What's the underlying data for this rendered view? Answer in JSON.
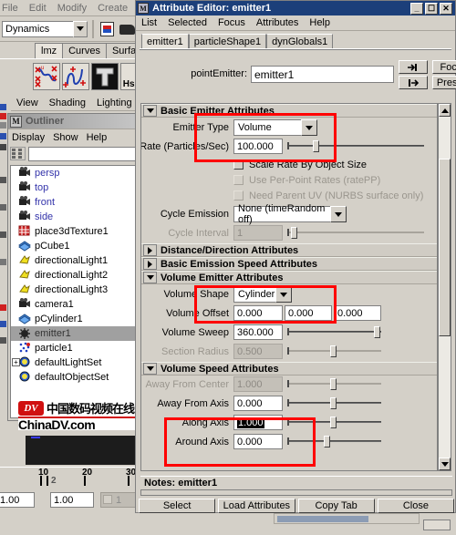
{
  "maya": {
    "menubar": [
      "File",
      "Edit",
      "Modify",
      "Create",
      "D"
    ],
    "menu_mode": "Dynamics",
    "shelf_tabs": [
      {
        "label": "lmz",
        "active": true
      },
      {
        "label": "Curves",
        "active": false
      },
      {
        "label": "Surface:",
        "active": false
      }
    ],
    "shelf_icons": [
      "scatter-curve-icon",
      "wave-curve-icon",
      "text-tool-icon",
      "hshc-icon",
      "ab-icon"
    ],
    "viewport_menu": [
      "View",
      "Shading",
      "Lighting"
    ],
    "outliner": {
      "title": "Outliner",
      "menu": [
        "Display",
        "Show",
        "Help"
      ],
      "search_value": "",
      "items": [
        {
          "label": "persp",
          "icon": "camera-icon",
          "blue": true,
          "selected": false,
          "expand": false
        },
        {
          "label": "top",
          "icon": "camera-icon",
          "blue": true,
          "selected": false,
          "expand": false
        },
        {
          "label": "front",
          "icon": "camera-icon",
          "blue": true,
          "selected": false,
          "expand": false
        },
        {
          "label": "side",
          "icon": "camera-icon",
          "blue": true,
          "selected": false,
          "expand": false
        },
        {
          "label": "place3dTexture1",
          "icon": "place3d-texture-icon",
          "blue": false,
          "selected": false,
          "expand": false
        },
        {
          "label": "pCube1",
          "icon": "mesh-icon",
          "blue": false,
          "selected": false,
          "expand": false
        },
        {
          "label": "directionalLight1",
          "icon": "directional-light-icon",
          "blue": false,
          "selected": false,
          "expand": false
        },
        {
          "label": "directionalLight2",
          "icon": "directional-light-icon",
          "blue": false,
          "selected": false,
          "expand": false
        },
        {
          "label": "directionalLight3",
          "icon": "directional-light-icon",
          "blue": false,
          "selected": false,
          "expand": false
        },
        {
          "label": "camera1",
          "icon": "camera-icon",
          "blue": false,
          "selected": false,
          "expand": false
        },
        {
          "label": "pCylinder1",
          "icon": "mesh-icon",
          "blue": false,
          "selected": false,
          "expand": false
        },
        {
          "label": "emitter1",
          "icon": "emitter-icon",
          "blue": false,
          "selected": true,
          "expand": false
        },
        {
          "label": "particle1",
          "icon": "particle-icon",
          "blue": false,
          "selected": false,
          "expand": false
        },
        {
          "label": "defaultLightSet",
          "icon": "set-icon",
          "blue": false,
          "selected": false,
          "expand": true
        },
        {
          "label": "defaultObjectSet",
          "icon": "set-icon",
          "blue": false,
          "selected": false,
          "expand": false
        }
      ]
    },
    "watermark": {
      "badge": "DV",
      "chinese": "中国数码视频在线",
      "domain": "ChinaDV.com"
    },
    "timeline": {
      "ticks": [
        "10",
        "20",
        "30"
      ],
      "current_frame": "2"
    },
    "fields": {
      "field1": "1.00",
      "field2": "1.00",
      "field3": "1"
    }
  },
  "attribute_editor": {
    "title": "Attribute Editor: emitter1",
    "window_buttons": [
      "minimize",
      "maximize",
      "close"
    ],
    "menu": [
      "List",
      "Selected",
      "Focus",
      "Attributes",
      "Help"
    ],
    "tabs": [
      {
        "label": "emitter1",
        "active": true
      },
      {
        "label": "particleShape1",
        "active": false
      },
      {
        "label": "dynGlobals1",
        "active": false
      }
    ],
    "node_label": "pointEmitter:",
    "node_value": "emitter1",
    "side_buttons": [
      "Focus",
      "Presets"
    ],
    "sections": [
      {
        "name": "Basic Emitter Attributes",
        "expanded": true,
        "rows": [
          {
            "type": "dropdown",
            "label": "Emitter Type",
            "value": "Volume"
          },
          {
            "type": "field_slider",
            "label": "Rate (Particles/Sec)",
            "value": "100.000",
            "disabled": false,
            "handle_pct": 18
          },
          {
            "type": "checkbox",
            "label": "Scale Rate By Object Size",
            "checked": false,
            "disabled": false
          },
          {
            "type": "checkbox",
            "label": "Use Per-Point Rates (ratePP)",
            "checked": false,
            "disabled": true
          },
          {
            "type": "checkbox",
            "label": "Need Parent UV (NURBS surface only)",
            "checked": false,
            "disabled": true
          },
          {
            "type": "dropdown",
            "label": "Cycle Emission",
            "value": "None (timeRandom off)"
          },
          {
            "type": "field_slider",
            "label": "Cycle Interval",
            "value": "1",
            "disabled": true,
            "handle_pct": 4
          }
        ]
      },
      {
        "name": "Distance/Direction Attributes",
        "expanded": false,
        "rows": []
      },
      {
        "name": "Basic Emission Speed Attributes",
        "expanded": false,
        "rows": []
      },
      {
        "name": "Volume Emitter Attributes",
        "expanded": true,
        "rows": [
          {
            "type": "dropdown",
            "label": "Volume Shape",
            "value": "Cylinder"
          },
          {
            "type": "triple_field",
            "label": "Volume Offset",
            "values": [
              "0.000",
              "0.000",
              "0.000"
            ]
          },
          {
            "type": "field_slider",
            "label": "Volume Sweep",
            "value": "360.000",
            "disabled": false,
            "handle_pct": 95
          },
          {
            "type": "field_slider",
            "label": "Section Radius",
            "value": "0.500",
            "disabled": true,
            "handle_pct": 48
          }
        ]
      },
      {
        "name": "Volume Speed Attributes",
        "expanded": true,
        "rows": [
          {
            "type": "field_slider",
            "label": "Away From Center",
            "value": "1.000",
            "disabled": true,
            "handle_pct": 48
          },
          {
            "type": "field_slider",
            "label": "Away From Axis",
            "value": "0.000",
            "disabled": false,
            "handle_pct": 48
          },
          {
            "type": "field_slider",
            "label": "Along Axis",
            "value": "1.000",
            "disabled": false,
            "selected": true,
            "handle_pct": 48
          },
          {
            "type": "field_slider",
            "label": "Around Axis",
            "value": "0.000",
            "disabled": false,
            "handle_pct": 48
          }
        ]
      }
    ],
    "notes_label": "Notes: emitter1",
    "notes_value": "",
    "buttons": [
      "Select",
      "Load Attributes",
      "Copy Tab",
      "Close"
    ]
  },
  "annotations": {
    "highlight_color": "#ff0000",
    "boxes": [
      "emitter-type-volume",
      "volume-shape-cylinder",
      "axis-speed-fields"
    ]
  }
}
